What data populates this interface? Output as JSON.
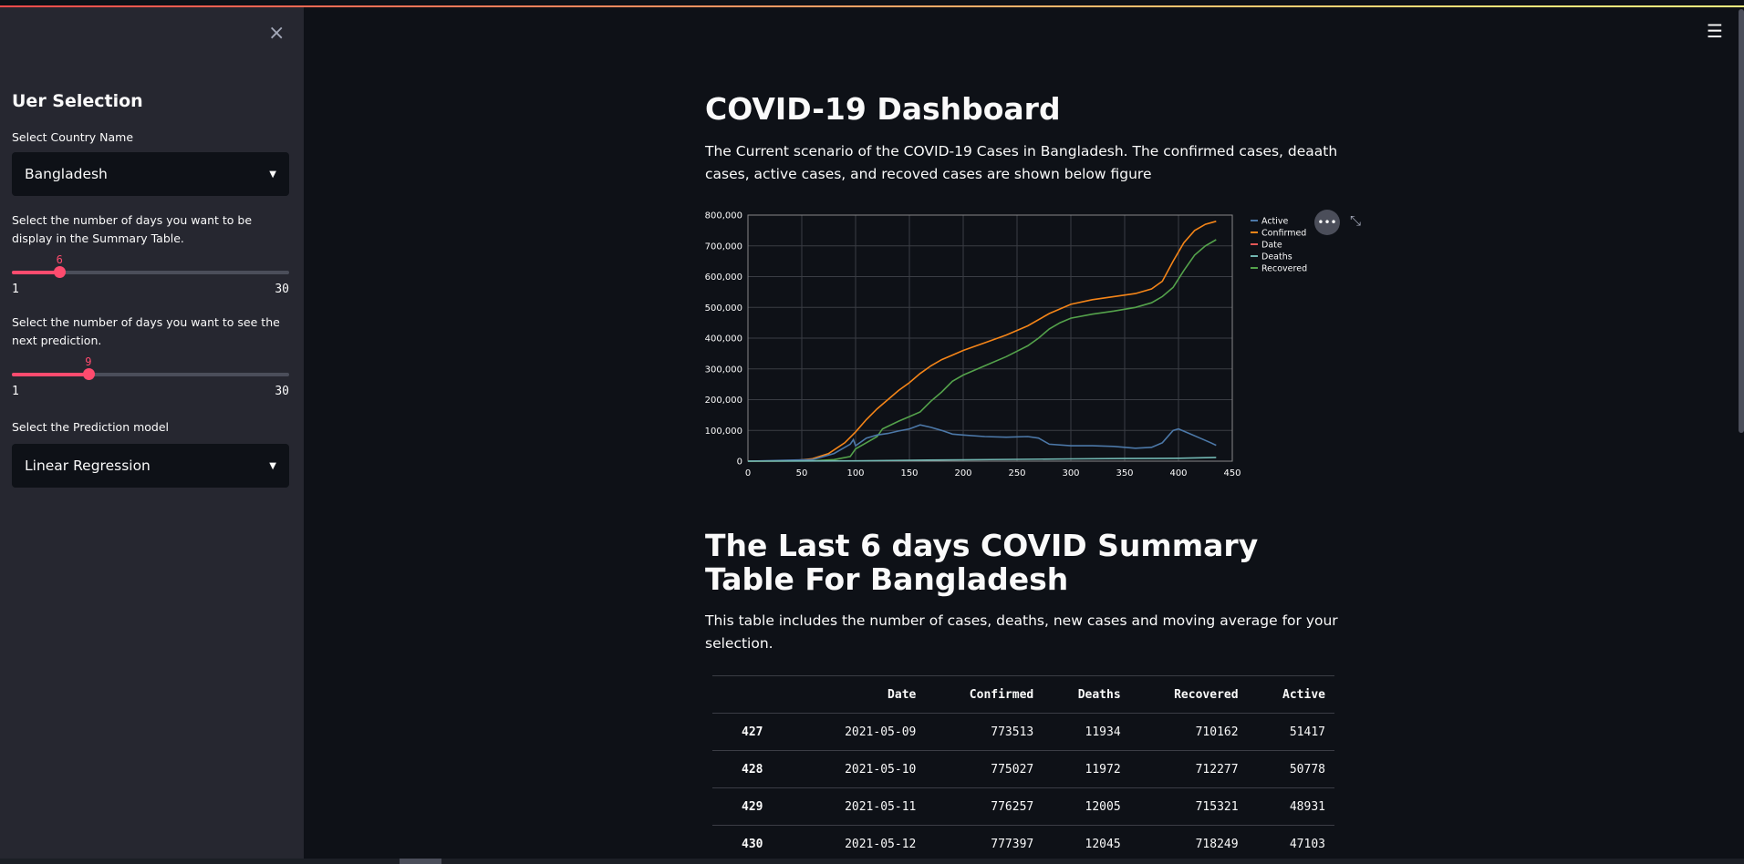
{
  "sidebar": {
    "close_glyph": "×",
    "title": "Uer Selection",
    "country_label": "Select Country Name",
    "country_value": "Bangladesh",
    "days_table_label": "Select the number of days you want to be display in the Summary Table.",
    "days_table": {
      "value": "6",
      "min": "1",
      "max": "30",
      "fraction": 0.172
    },
    "days_pred_label": "Select the number of days you want to see the next prediction.",
    "days_pred": {
      "value": "9",
      "min": "1",
      "max": "30",
      "fraction": 0.276
    },
    "model_label": "Select the Prediction model",
    "model_value": "Linear Regression"
  },
  "header": {
    "menu_glyph": "☰"
  },
  "main": {
    "title": "COVID-19 Dashboard",
    "description": "The Current scenario of the COVID-19 Cases in Bangladesh. The confirmed cases, deaath cases, active cases, and recoved cases are shown below figure",
    "summary_title": "The Last 6 days COVID Summary Table For Bangladesh",
    "summary_desc": "This table includes the number of cases, deaths, new cases and moving average for your selection."
  },
  "chart_controls": {
    "more_glyph": "•••",
    "expand_glyph": "⤡"
  },
  "chart_data": {
    "type": "line",
    "xlim": [
      0,
      450
    ],
    "ylim": [
      0,
      800000
    ],
    "xticks": [
      "0",
      "50",
      "100",
      "150",
      "200",
      "250",
      "300",
      "350",
      "400",
      "450"
    ],
    "yticks": [
      "0",
      "100,000",
      "200,000",
      "300,000",
      "400,000",
      "500,000",
      "600,000",
      "700,000",
      "800,000"
    ],
    "legend": [
      "Active",
      "Confirmed",
      "Date",
      "Deaths",
      "Recovered"
    ],
    "colors": {
      "Active": "#4c78a8",
      "Confirmed": "#f58518",
      "Date": "#e45756",
      "Deaths": "#72b7b2",
      "Recovered": "#54a24b"
    },
    "grid": true,
    "legend_position": "right",
    "series": [
      {
        "name": "Confirmed",
        "points": [
          [
            0,
            0
          ],
          [
            40,
            1000
          ],
          [
            60,
            8000
          ],
          [
            75,
            25000
          ],
          [
            90,
            60000
          ],
          [
            100,
            95000
          ],
          [
            110,
            135000
          ],
          [
            120,
            170000
          ],
          [
            130,
            200000
          ],
          [
            140,
            230000
          ],
          [
            150,
            255000
          ],
          [
            160,
            285000
          ],
          [
            170,
            310000
          ],
          [
            180,
            330000
          ],
          [
            190,
            345000
          ],
          [
            200,
            360000
          ],
          [
            220,
            385000
          ],
          [
            240,
            410000
          ],
          [
            260,
            440000
          ],
          [
            280,
            480000
          ],
          [
            300,
            510000
          ],
          [
            320,
            525000
          ],
          [
            340,
            535000
          ],
          [
            360,
            545000
          ],
          [
            375,
            560000
          ],
          [
            385,
            585000
          ],
          [
            395,
            650000
          ],
          [
            405,
            710000
          ],
          [
            415,
            750000
          ],
          [
            425,
            770000
          ],
          [
            435,
            780000
          ]
        ]
      },
      {
        "name": "Recovered",
        "points": [
          [
            0,
            0
          ],
          [
            60,
            1000
          ],
          [
            80,
            5000
          ],
          [
            95,
            15000
          ],
          [
            100,
            40000
          ],
          [
            110,
            60000
          ],
          [
            120,
            80000
          ],
          [
            125,
            105000
          ],
          [
            140,
            130000
          ],
          [
            150,
            145000
          ],
          [
            160,
            160000
          ],
          [
            170,
            195000
          ],
          [
            180,
            225000
          ],
          [
            190,
            260000
          ],
          [
            200,
            280000
          ],
          [
            220,
            310000
          ],
          [
            240,
            340000
          ],
          [
            260,
            375000
          ],
          [
            270,
            400000
          ],
          [
            280,
            430000
          ],
          [
            290,
            450000
          ],
          [
            300,
            465000
          ],
          [
            320,
            478000
          ],
          [
            340,
            488000
          ],
          [
            360,
            500000
          ],
          [
            375,
            515000
          ],
          [
            385,
            535000
          ],
          [
            395,
            565000
          ],
          [
            405,
            620000
          ],
          [
            415,
            670000
          ],
          [
            425,
            700000
          ],
          [
            435,
            720000
          ]
        ]
      },
      {
        "name": "Active",
        "points": [
          [
            0,
            0
          ],
          [
            60,
            5000
          ],
          [
            80,
            25000
          ],
          [
            95,
            55000
          ],
          [
            98,
            70000
          ],
          [
            100,
            50000
          ],
          [
            110,
            75000
          ],
          [
            120,
            85000
          ],
          [
            130,
            90000
          ],
          [
            140,
            98000
          ],
          [
            150,
            105000
          ],
          [
            160,
            118000
          ],
          [
            170,
            110000
          ],
          [
            180,
            100000
          ],
          [
            190,
            88000
          ],
          [
            200,
            85000
          ],
          [
            220,
            80000
          ],
          [
            240,
            78000
          ],
          [
            260,
            80000
          ],
          [
            270,
            75000
          ],
          [
            280,
            55000
          ],
          [
            300,
            50000
          ],
          [
            320,
            50000
          ],
          [
            340,
            48000
          ],
          [
            360,
            42000
          ],
          [
            375,
            45000
          ],
          [
            385,
            60000
          ],
          [
            395,
            100000
          ],
          [
            400,
            105000
          ],
          [
            410,
            90000
          ],
          [
            420,
            75000
          ],
          [
            430,
            60000
          ],
          [
            435,
            51417
          ]
        ]
      },
      {
        "name": "Deaths",
        "points": [
          [
            0,
            0
          ],
          [
            100,
            1000
          ],
          [
            150,
            3000
          ],
          [
            200,
            4500
          ],
          [
            250,
            6000
          ],
          [
            300,
            7500
          ],
          [
            350,
            8500
          ],
          [
            400,
            9500
          ],
          [
            435,
            12045
          ]
        ]
      }
    ]
  },
  "table": {
    "headers": [
      "",
      "Date",
      "Confirmed",
      "Deaths",
      "Recovered",
      "Active"
    ],
    "rows": [
      [
        "427",
        "2021-05-09",
        "773513",
        "11934",
        "710162",
        "51417"
      ],
      [
        "428",
        "2021-05-10",
        "775027",
        "11972",
        "712277",
        "50778"
      ],
      [
        "429",
        "2021-05-11",
        "776257",
        "12005",
        "715321",
        "48931"
      ],
      [
        "430",
        "2021-05-12",
        "777397",
        "12045",
        "718249",
        "47103"
      ]
    ]
  }
}
